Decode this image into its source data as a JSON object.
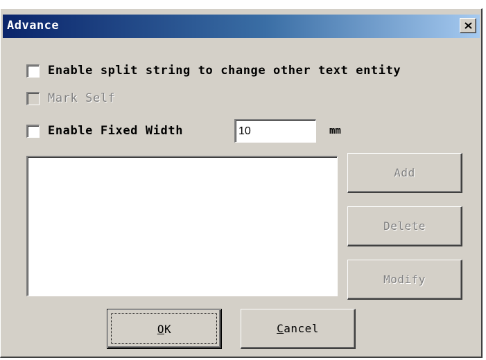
{
  "window": {
    "title": "Advance",
    "close_glyph": "close-icon"
  },
  "options": {
    "split_string_label": "Enable split string to change other text entity",
    "split_string_checked": false,
    "mark_self_label": "Mark Self",
    "mark_self_checked": false,
    "mark_self_enabled": false,
    "fixed_width_label": "Enable Fixed Width",
    "fixed_width_checked": false,
    "fixed_width_value": "10",
    "fixed_width_unit": "mm"
  },
  "list": {
    "items": []
  },
  "side_buttons": {
    "add_label": "Add",
    "delete_label": "Delete",
    "modify_label": "Modify"
  },
  "footer_buttons": {
    "ok_mnemonic": "O",
    "ok_rest": "K",
    "cancel_mnemonic": "C",
    "cancel_rest": "ancel"
  }
}
